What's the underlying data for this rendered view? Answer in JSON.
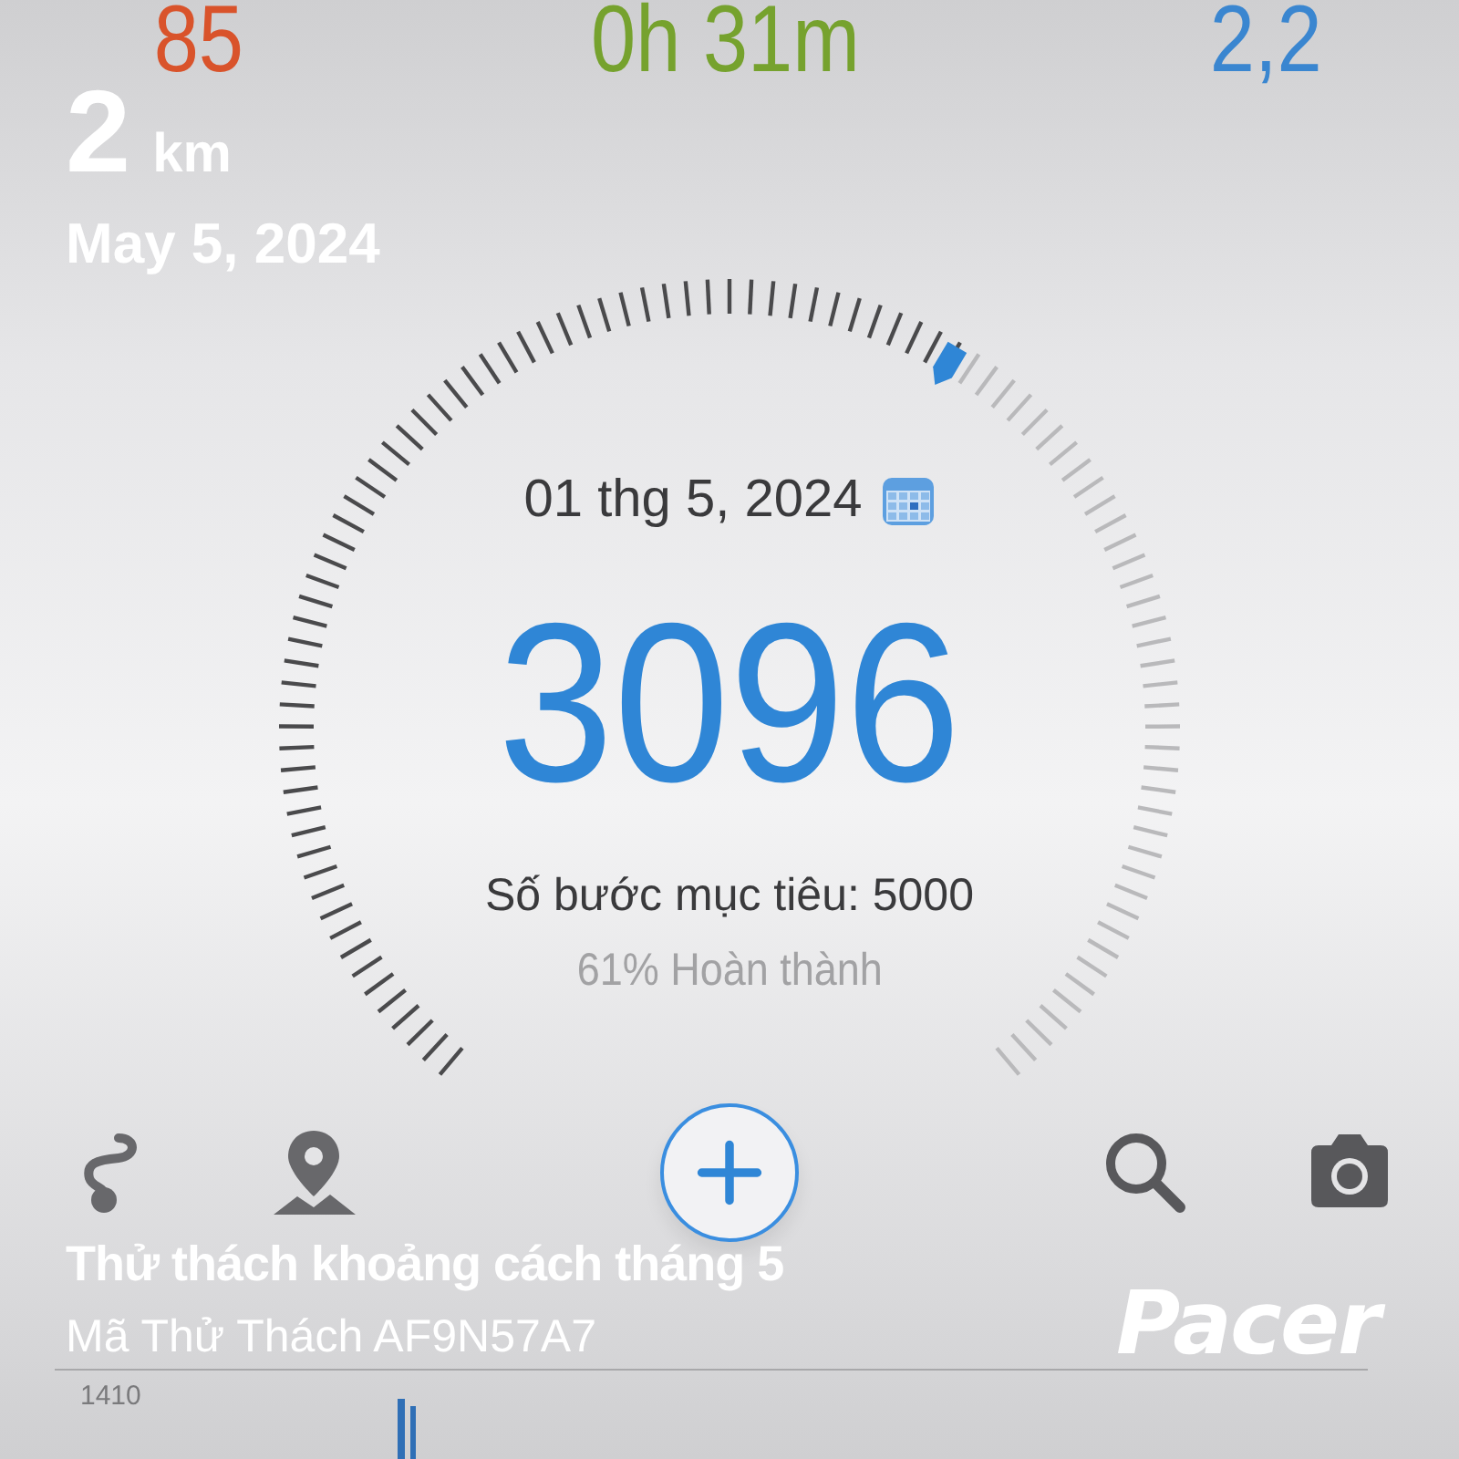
{
  "top_stats": [
    {
      "value": "85",
      "color": "#d9532b"
    },
    {
      "value": "0h 31m",
      "color": "#76a22e"
    },
    {
      "value": "2,2",
      "color": "#3a86d0"
    }
  ],
  "overlay": {
    "distance": "2",
    "unit": "km",
    "date": "May 5, 2024"
  },
  "gauge": {
    "date": "01 thg 5, 2024",
    "steps": "3096",
    "goal": "Số bước mục tiêu: 5000",
    "percent": "61% Hoàn thành"
  },
  "challenge": {
    "title": "Thử thách khoảng cách tháng 5",
    "code": "Mã Thử Thách AF9N57A7"
  },
  "logo": "Pacer",
  "chart": {
    "axis_label": "1410"
  }
}
